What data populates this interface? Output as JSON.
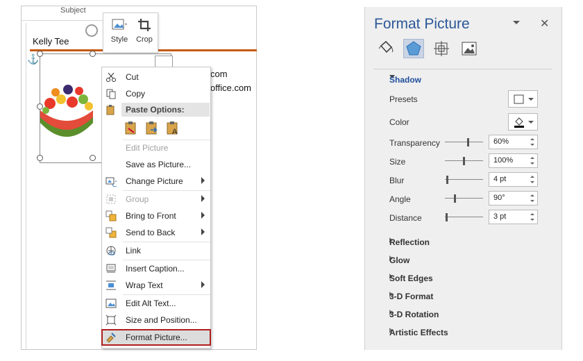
{
  "doc": {
    "subject_label": "Subject",
    "sender_name": "Kelly Tee",
    "text_line1": "com",
    "text_line2": "office.com"
  },
  "mini_toolbar": {
    "style_label": "Style",
    "crop_label": "Crop"
  },
  "context_menu": {
    "items": [
      {
        "label": "Cut",
        "icon": "scissors-icon",
        "enabled": true
      },
      {
        "label": "Copy",
        "icon": "copy-icon",
        "enabled": true
      },
      {
        "label": "Edit Picture",
        "icon": "",
        "enabled": false
      },
      {
        "label": "Save as Picture...",
        "icon": "",
        "enabled": true
      },
      {
        "label": "Change Picture",
        "icon": "change-picture-icon",
        "enabled": true,
        "submenu": true
      },
      {
        "label": "Group",
        "icon": "group-icon",
        "enabled": false,
        "submenu": true
      },
      {
        "label": "Bring to Front",
        "icon": "bring-to-front-icon",
        "enabled": true,
        "submenu": true
      },
      {
        "label": "Send to Back",
        "icon": "send-to-back-icon",
        "enabled": true,
        "submenu": true
      },
      {
        "label": "Link",
        "icon": "link-icon",
        "enabled": true
      },
      {
        "label": "Insert Caption...",
        "icon": "insert-caption-icon",
        "enabled": true
      },
      {
        "label": "Wrap Text",
        "icon": "wrap-text-icon",
        "enabled": true,
        "submenu": true
      },
      {
        "label": "Edit Alt Text...",
        "icon": "alt-text-icon",
        "enabled": true
      },
      {
        "label": "Size and Position...",
        "icon": "size-position-icon",
        "enabled": true
      },
      {
        "label": "Format Picture...",
        "icon": "format-picture-icon",
        "enabled": true,
        "highlighted": true
      }
    ],
    "paste_options_label": "Paste Options:"
  },
  "pane": {
    "title": "Format Picture",
    "tabs": [
      "fill-line-icon",
      "effects-icon",
      "layout-properties-icon",
      "picture-icon"
    ],
    "selected_tab": "effects-icon",
    "shadow": {
      "section_label": "Shadow",
      "presets_label": "Presets",
      "color_label": "Color",
      "transparency_label": "Transparency",
      "transparency_value": "60%",
      "size_label": "Size",
      "size_value": "100%",
      "blur_label": "Blur",
      "blur_value": "4 pt",
      "angle_label": "Angle",
      "angle_value": "90°",
      "distance_label": "Distance",
      "distance_value": "3 pt"
    },
    "sections": [
      "Reflection",
      "Glow",
      "Soft Edges",
      "3-D Format",
      "3-D Rotation",
      "Artistic Effects"
    ]
  },
  "colors": {
    "accent_blue": "#2b5797",
    "section_blue": "#1f4e9c",
    "highlight_red": "#b01d1d",
    "rule_orange": "#c55a11",
    "pane_bg": "#efefef"
  }
}
